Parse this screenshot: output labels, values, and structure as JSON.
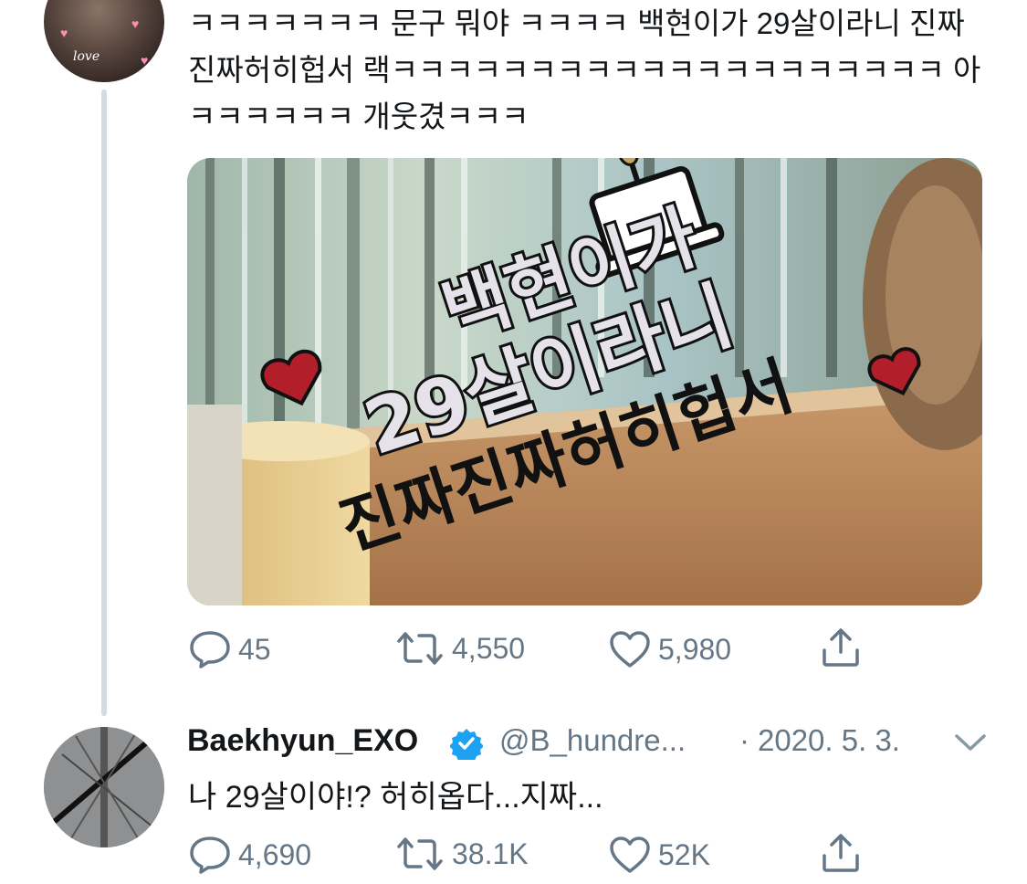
{
  "reply_tweet": {
    "text": "ㅋㅋㅋㅋㅋㅋㅋ 문구 뭐야 ㅋㅋㅋㅋ 백현이가 29살이라니 진짜진짜허히헙서 랙ㅋㅋㅋㅋㅋㅋㅋㅋㅋㅋㅋㅋㅋㅋㅋㅋㅋㅋㅋㅋ 아 ㅋㅋㅋㅋㅋㅋ 개웃겼ㅋㅋㅋ",
    "avatar_label": "love",
    "image": {
      "topper_line1": "백현이가",
      "topper_line2": "29살이라니",
      "topper_line3": "진짜진짜허히헙서"
    },
    "actions": {
      "replies": "45",
      "retweets": "4,550",
      "likes": "5,980"
    }
  },
  "original_tweet": {
    "display_name": "Baekhyun_EXO",
    "handle": "@B_hundre...",
    "separator": "·",
    "date": "2020. 5. 3.",
    "text": "나 29살이야!? 허히옵다...지짜...",
    "actions": {
      "replies": "4,690",
      "retweets": "38.1K",
      "likes": "52K"
    }
  },
  "colors": {
    "text": "#14171a",
    "secondary": "#657786",
    "verified": "#1da1f2",
    "thread_line": "#d4dbe1"
  },
  "icons": [
    "reply-icon",
    "retweet-icon",
    "like-icon",
    "share-icon",
    "verified-badge-icon",
    "chevron-down-icon"
  ]
}
